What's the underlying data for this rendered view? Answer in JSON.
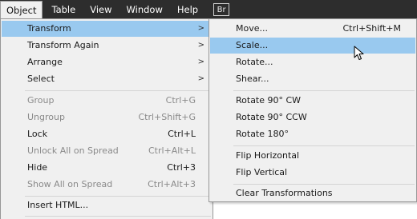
{
  "menubar": {
    "items": [
      "Object",
      "Table",
      "View",
      "Window",
      "Help"
    ],
    "badge": "Br"
  },
  "main_menu": {
    "items": [
      {
        "label": "Transform",
        "shortcut": "",
        "submenu": true,
        "state": "highlighted"
      },
      {
        "label": "Transform Again",
        "shortcut": "",
        "submenu": true,
        "state": "enabled"
      },
      {
        "label": "Arrange",
        "shortcut": "",
        "submenu": true,
        "state": "enabled"
      },
      {
        "label": "Select",
        "shortcut": "",
        "submenu": true,
        "state": "enabled"
      },
      {
        "label": "Group",
        "shortcut": "Ctrl+G",
        "submenu": false,
        "state": "disabled"
      },
      {
        "label": "Ungroup",
        "shortcut": "Ctrl+Shift+G",
        "submenu": false,
        "state": "disabled"
      },
      {
        "label": "Lock",
        "shortcut": "Ctrl+L",
        "submenu": false,
        "state": "enabled"
      },
      {
        "label": "Unlock All on Spread",
        "shortcut": "Ctrl+Alt+L",
        "submenu": false,
        "state": "disabled"
      },
      {
        "label": "Hide",
        "shortcut": "Ctrl+3",
        "submenu": false,
        "state": "enabled"
      },
      {
        "label": "Show All on Spread",
        "shortcut": "Ctrl+Alt+3",
        "submenu": false,
        "state": "disabled"
      },
      {
        "label": "Insert HTML...",
        "shortcut": "",
        "submenu": false,
        "state": "enabled"
      }
    ],
    "submenu_arrow": ">"
  },
  "transform_submenu": {
    "items": [
      {
        "label": "Move...",
        "shortcut": "Ctrl+Shift+M",
        "state": "enabled"
      },
      {
        "label": "Scale...",
        "shortcut": "",
        "state": "highlighted"
      },
      {
        "label": "Rotate...",
        "shortcut": "",
        "state": "enabled"
      },
      {
        "label": "Shear...",
        "shortcut": "",
        "state": "enabled"
      },
      {
        "label": "Rotate 90° CW",
        "shortcut": "",
        "state": "enabled"
      },
      {
        "label": "Rotate 90° CCW",
        "shortcut": "",
        "state": "enabled"
      },
      {
        "label": "Rotate 180°",
        "shortcut": "",
        "state": "enabled"
      },
      {
        "label": "Flip Horizontal",
        "shortcut": "",
        "state": "enabled"
      },
      {
        "label": "Flip Vertical",
        "shortcut": "",
        "state": "enabled"
      },
      {
        "label": "Clear Transformations",
        "shortcut": "",
        "state": "enabled"
      }
    ]
  },
  "colors": {
    "menubar_bg": "#2d2d2d",
    "menu_bg": "#f0f0f0",
    "highlight": "#99c9ef",
    "disabled_text": "#8a8a8a"
  }
}
